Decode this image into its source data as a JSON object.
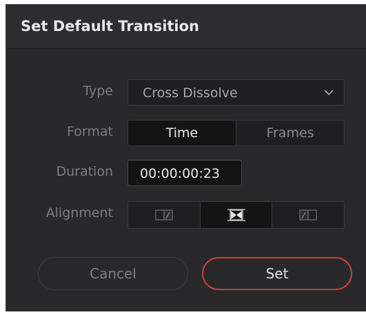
{
  "dialog": {
    "title": "Set Default Transition",
    "type_label": "Type",
    "type_value": "Cross Dissolve",
    "format_label": "Format",
    "format_options": [
      "Time",
      "Frames"
    ],
    "format_selected": "Time",
    "duration_label": "Duration",
    "duration_value": "00:00:00:23",
    "alignment_label": "Alignment",
    "alignment_options": [
      "align-end-icon",
      "align-center-icon",
      "align-start-icon"
    ],
    "alignment_selected": "align-center-icon",
    "cancel_label": "Cancel",
    "set_label": "Set"
  },
  "colors": {
    "background": "#29292b",
    "accent": "#d23d3d",
    "text": "#e9e9ec",
    "muted": "#7d7d82"
  }
}
